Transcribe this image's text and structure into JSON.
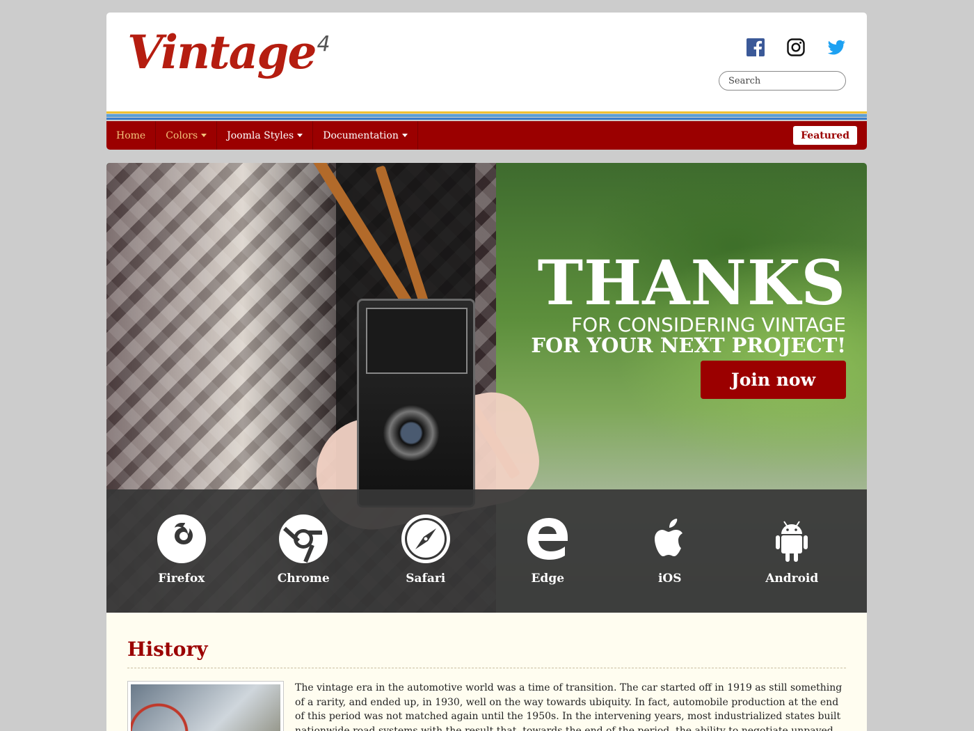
{
  "header": {
    "logo_text": "Vintage",
    "logo_superscript": "4",
    "search_placeholder": "Search",
    "social": [
      "facebook-icon",
      "instagram-icon",
      "twitter-icon"
    ]
  },
  "nav": {
    "items": [
      {
        "label": "Home",
        "has_dropdown": false
      },
      {
        "label": "Colors",
        "has_dropdown": true
      },
      {
        "label": "Joomla Styles",
        "has_dropdown": true
      },
      {
        "label": "Documentation",
        "has_dropdown": true
      }
    ],
    "featured_label": "Featured"
  },
  "hero": {
    "title": "THANKS",
    "subtitle_line1": "FOR CONSIDERING VINTAGE",
    "subtitle_line2": "FOR YOUR NEXT PROJECT!",
    "cta_label": "Join now"
  },
  "browsers": [
    {
      "label": "Firefox",
      "icon": "firefox-icon"
    },
    {
      "label": "Chrome",
      "icon": "chrome-icon"
    },
    {
      "label": "Safari",
      "icon": "safari-icon"
    },
    {
      "label": "Edge",
      "icon": "edge-icon"
    },
    {
      "label": "iOS",
      "icon": "apple-icon"
    },
    {
      "label": "Android",
      "icon": "android-icon"
    }
  ],
  "history": {
    "title": "History",
    "text": "The vintage era in the automotive world was a time of transition. The car started off in 1919 as still something of a rarity, and ended up, in 1930, well on the way towards ubiquity. In fact, automobile production at the end of this period was not matched again until the 1950s. In the intervening years, most industrialized states built nationwide road systems with the result that, towards the end of the period, the ability to negotiate unpaved roads was no longer a prime consideration of automotive design."
  },
  "colors": {
    "brand_red": "#9b0000",
    "logo_red": "#b51d10",
    "stripe_yellow": "#f1c232",
    "stripe_blue": "#3a7ecb",
    "history_bg": "#fffdf0"
  }
}
